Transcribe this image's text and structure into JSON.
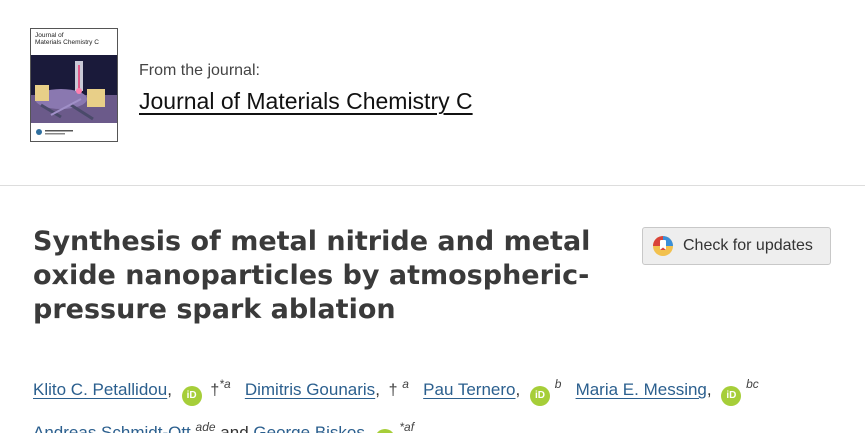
{
  "journal": {
    "cover": {
      "title_line1": "Journal of",
      "title_line2": "Materials Chemistry C"
    },
    "from_label": "From the journal:",
    "name": "Journal of Materials Chemistry C"
  },
  "article": {
    "title": "Synthesis of metal nitride and metal oxide nanoparticles by atmospheric-pressure spark ablation",
    "check_updates_label": "Check for updates"
  },
  "authors": {
    "list": [
      {
        "name": "Klito C. Petallidou",
        "orcid": true,
        "mark": "†",
        "aff": "*a",
        "sep": ""
      },
      {
        "name": "Dimitris Gounaris",
        "orcid": false,
        "mark": "†",
        "aff": "a",
        "sep": ""
      },
      {
        "name": "Pau Ternero",
        "orcid": true,
        "mark": "",
        "aff": "b",
        "sep": ""
      },
      {
        "name": "Maria E. Messing",
        "orcid": true,
        "mark": "",
        "aff": "bc",
        "sep": ""
      },
      {
        "name": "Andreas Schmidt-Ott",
        "orcid": false,
        "mark": "",
        "aff": "ade",
        "sep": "and"
      },
      {
        "name": "George Biskos",
        "orcid": true,
        "mark": "",
        "aff": "*af",
        "sep": ""
      }
    ],
    "comma": ",",
    "orcid_label": "iD"
  }
}
